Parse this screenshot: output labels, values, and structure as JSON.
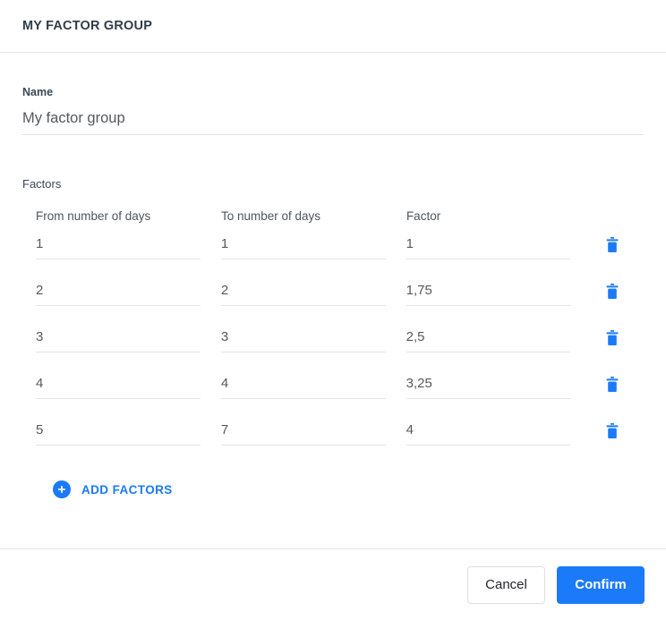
{
  "header": {
    "title": "MY FACTOR GROUP"
  },
  "form": {
    "name_label": "Name",
    "name_value": "My factor group",
    "name_placeholder": "Name"
  },
  "factors": {
    "section_label": "Factors",
    "columns": [
      "From number of days",
      "To number of days",
      "Factor"
    ],
    "rows": [
      {
        "from": "1",
        "to": "1",
        "factor": "1"
      },
      {
        "from": "2",
        "to": "2",
        "factor": "1,75"
      },
      {
        "from": "3",
        "to": "3",
        "factor": "2,5"
      },
      {
        "from": "4",
        "to": "4",
        "factor": "3,25"
      },
      {
        "from": "5",
        "to": "7",
        "factor": "4"
      }
    ],
    "delete_icon": "trash-icon",
    "add_label": "ADD FACTORS",
    "add_icon": "plus-circle-icon"
  },
  "footer": {
    "cancel_label": "Cancel",
    "confirm_label": "Confirm"
  },
  "colors": {
    "accent": "#1a7af8",
    "title": "#313c48",
    "text": "#56595d",
    "divider": "#e8e8e8",
    "underline": "#e4e4e4",
    "cancel_border": "#dcdfe3"
  }
}
